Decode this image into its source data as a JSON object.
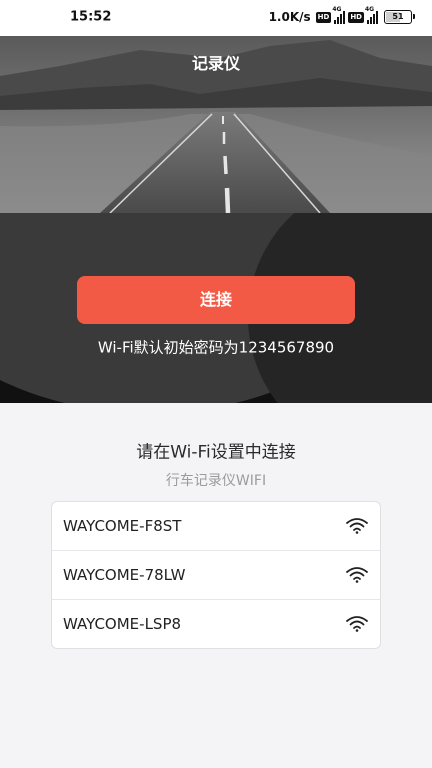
{
  "status_bar": {
    "time": "15:52",
    "network_speed": "1.0K/s",
    "hd_badge": "HD",
    "network_type": "4G",
    "battery_level": "51"
  },
  "header": {
    "title": "记录仪"
  },
  "connect": {
    "button_label": "连接",
    "password_hint": "Wi-Fi默认初始密码为1234567890"
  },
  "wifi_section": {
    "heading": "请在Wi-Fi设置中连接",
    "subheading": "行车记录仪WIFI",
    "networks": [
      {
        "ssid": "WAYCOME-F8ST",
        "icon": "wifi-icon"
      },
      {
        "ssid": "WAYCOME-78LW",
        "icon": "wifi-icon"
      },
      {
        "ssid": "WAYCOME-LSP8",
        "icon": "wifi-icon"
      }
    ]
  },
  "colors": {
    "accent": "#f35a45",
    "panel_dark": "#111111",
    "background": "#f4f4f6"
  }
}
